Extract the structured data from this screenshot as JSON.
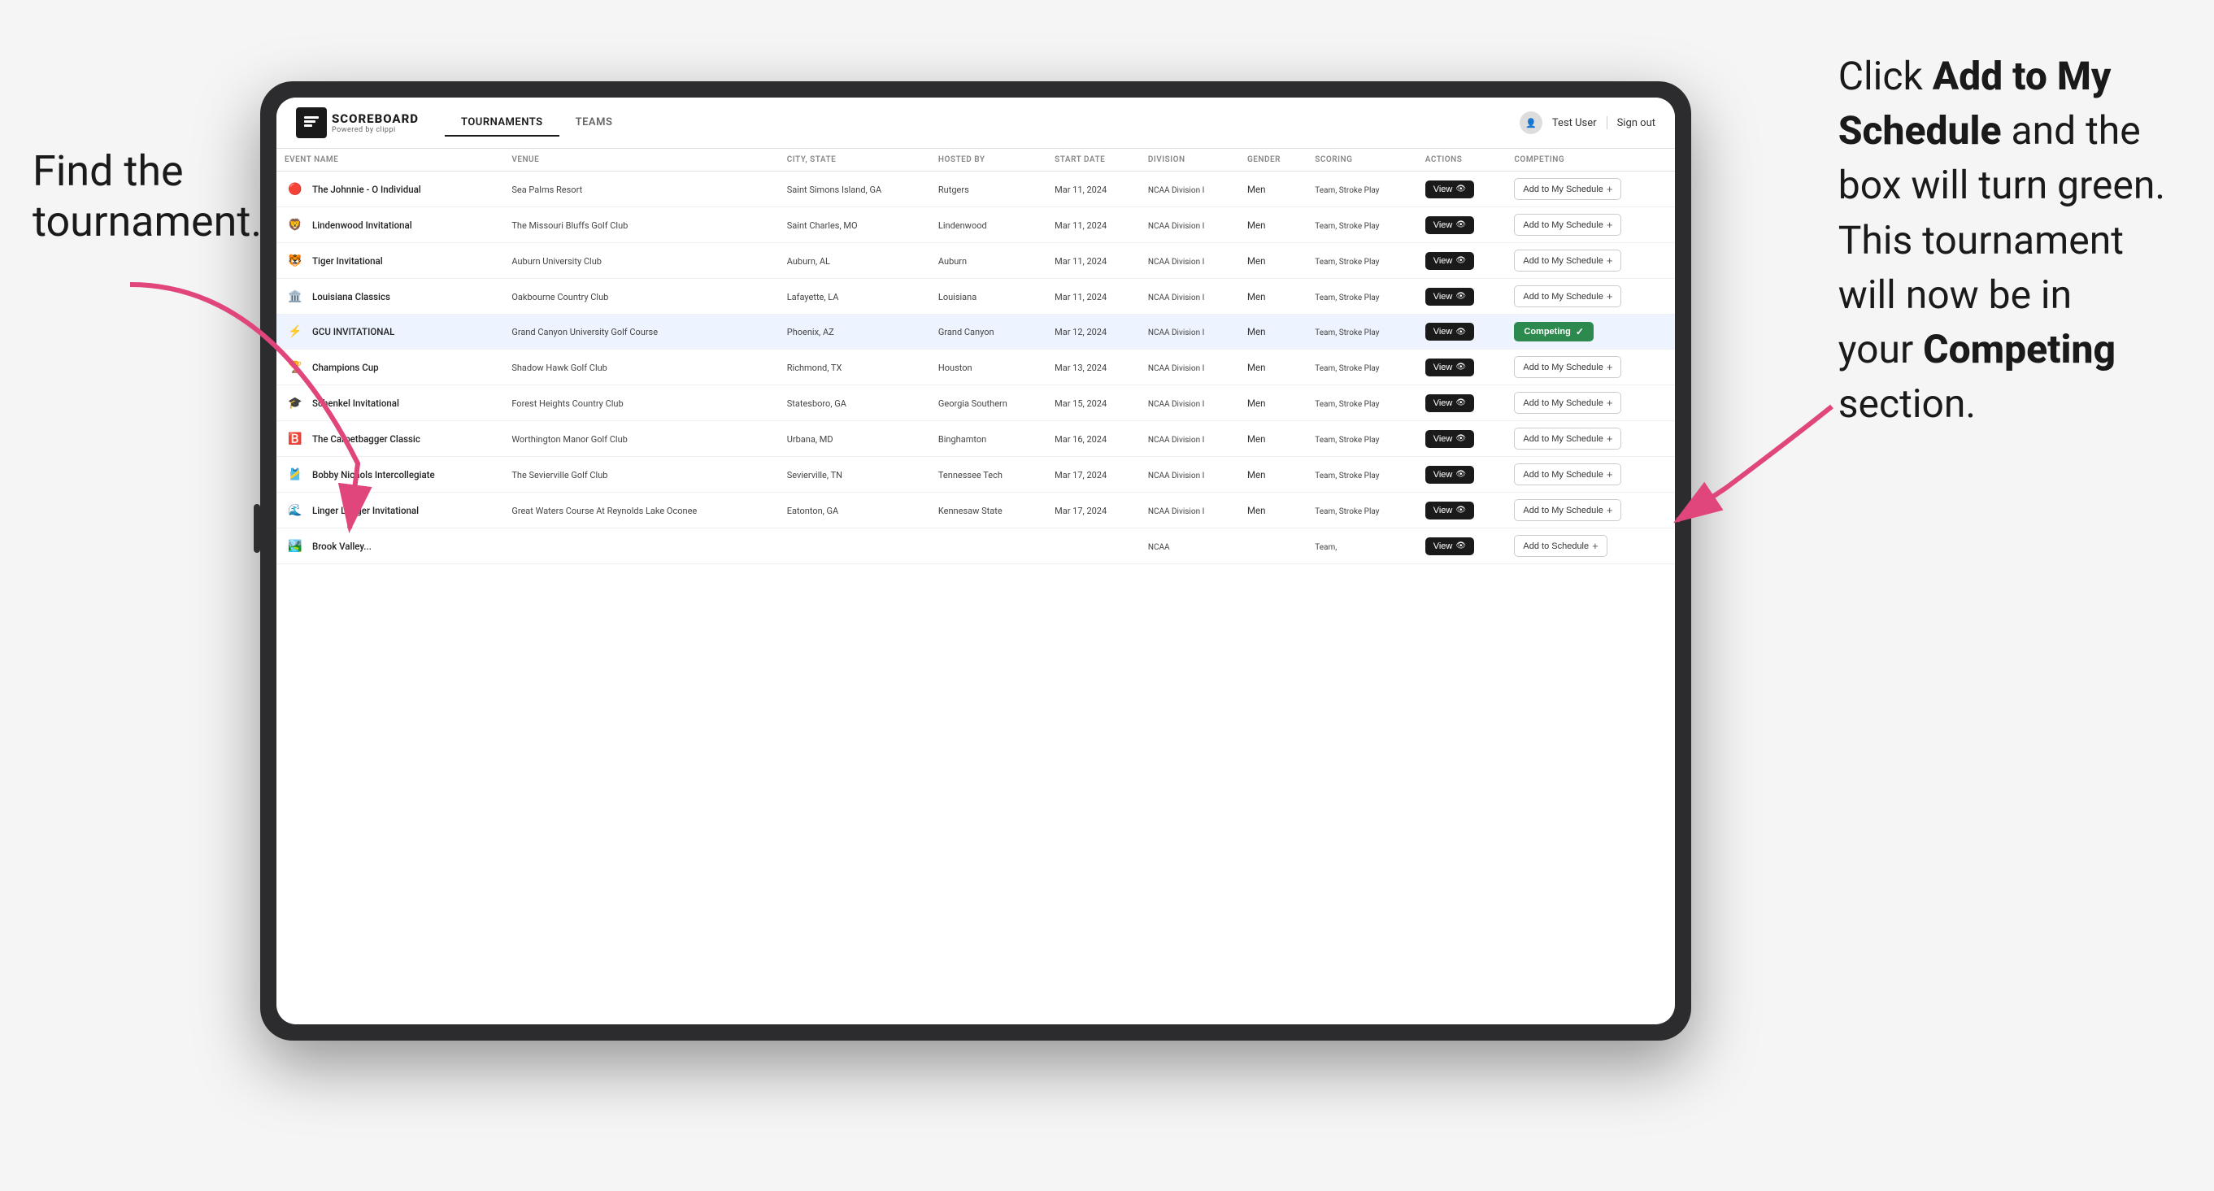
{
  "annotations": {
    "left": "Find the\ntournament.",
    "right_line1": "Click ",
    "right_bold1": "Add to My",
    "right_line2": "Schedule",
    "right_suffix": " and the",
    "right_line3": "box will turn green.",
    "right_line4": "This tournament",
    "right_line5": "will now be in",
    "right_line6": "your ",
    "right_bold2": "Competing",
    "right_line7": " section."
  },
  "header": {
    "logo_title": "SCOREBOARD",
    "logo_subtitle": "Powered by clippi",
    "nav_tabs": [
      {
        "label": "TOURNAMENTS",
        "active": true
      },
      {
        "label": "TEAMS",
        "active": false
      }
    ],
    "user": "Test User",
    "sign_out": "Sign out"
  },
  "table": {
    "columns": [
      "EVENT NAME",
      "VENUE",
      "CITY, STATE",
      "HOSTED BY",
      "START DATE",
      "DIVISION",
      "GENDER",
      "SCORING",
      "ACTIONS",
      "COMPETING"
    ],
    "rows": [
      {
        "logo": "🔴",
        "event_name": "The Johnnie - O Individual",
        "venue": "Sea Palms Resort",
        "city": "Saint Simons Island, GA",
        "hosted_by": "Rutgers",
        "start_date": "Mar 11, 2024",
        "division": "NCAA Division I",
        "gender": "Men",
        "scoring": "Team, Stroke Play",
        "action": "View",
        "competing": "Add to My Schedule",
        "highlighted": false,
        "competing_active": false
      },
      {
        "logo": "🦁",
        "event_name": "Lindenwood Invitational",
        "venue": "The Missouri Bluffs Golf Club",
        "city": "Saint Charles, MO",
        "hosted_by": "Lindenwood",
        "start_date": "Mar 11, 2024",
        "division": "NCAA Division I",
        "gender": "Men",
        "scoring": "Team, Stroke Play",
        "action": "View",
        "competing": "Add to My Schedule",
        "highlighted": false,
        "competing_active": false
      },
      {
        "logo": "🐯",
        "event_name": "Tiger Invitational",
        "venue": "Auburn University Club",
        "city": "Auburn, AL",
        "hosted_by": "Auburn",
        "start_date": "Mar 11, 2024",
        "division": "NCAA Division I",
        "gender": "Men",
        "scoring": "Team, Stroke Play",
        "action": "View",
        "competing": "Add to My Schedule",
        "highlighted": false,
        "competing_active": false
      },
      {
        "logo": "🏛️",
        "event_name": "Louisiana Classics",
        "venue": "Oakbourne Country Club",
        "city": "Lafayette, LA",
        "hosted_by": "Louisiana",
        "start_date": "Mar 11, 2024",
        "division": "NCAA Division I",
        "gender": "Men",
        "scoring": "Team, Stroke Play",
        "action": "View",
        "competing": "Add to My Schedule",
        "highlighted": false,
        "competing_active": false
      },
      {
        "logo": "⚡",
        "event_name": "GCU INVITATIONAL",
        "venue": "Grand Canyon University Golf Course",
        "city": "Phoenix, AZ",
        "hosted_by": "Grand Canyon",
        "start_date": "Mar 12, 2024",
        "division": "NCAA Division I",
        "gender": "Men",
        "scoring": "Team, Stroke Play",
        "action": "View",
        "competing": "Competing",
        "highlighted": true,
        "competing_active": true
      },
      {
        "logo": "🏆",
        "event_name": "Champions Cup",
        "venue": "Shadow Hawk Golf Club",
        "city": "Richmond, TX",
        "hosted_by": "Houston",
        "start_date": "Mar 13, 2024",
        "division": "NCAA Division I",
        "gender": "Men",
        "scoring": "Team, Stroke Play",
        "action": "View",
        "competing": "Add to My Schedule",
        "highlighted": false,
        "competing_active": false
      },
      {
        "logo": "🎓",
        "event_name": "Schenkel Invitational",
        "venue": "Forest Heights Country Club",
        "city": "Statesboro, GA",
        "hosted_by": "Georgia Southern",
        "start_date": "Mar 15, 2024",
        "division": "NCAA Division I",
        "gender": "Men",
        "scoring": "Team, Stroke Play",
        "action": "View",
        "competing": "Add to My Schedule",
        "highlighted": false,
        "competing_active": false
      },
      {
        "logo": "🅱️",
        "event_name": "The Carpetbagger Classic",
        "venue": "Worthington Manor Golf Club",
        "city": "Urbana, MD",
        "hosted_by": "Binghamton",
        "start_date": "Mar 16, 2024",
        "division": "NCAA Division I",
        "gender": "Men",
        "scoring": "Team, Stroke Play",
        "action": "View",
        "competing": "Add to My Schedule",
        "highlighted": false,
        "competing_active": false
      },
      {
        "logo": "🎽",
        "event_name": "Bobby Nichols Intercollegiate",
        "venue": "The Sevierville Golf Club",
        "city": "Sevierville, TN",
        "hosted_by": "Tennessee Tech",
        "start_date": "Mar 17, 2024",
        "division": "NCAA Division I",
        "gender": "Men",
        "scoring": "Team, Stroke Play",
        "action": "View",
        "competing": "Add to My Schedule",
        "highlighted": false,
        "competing_active": false
      },
      {
        "logo": "🌊",
        "event_name": "Linger Longer Invitational",
        "venue": "Great Waters Course At Reynolds Lake Oconee",
        "city": "Eatonton, GA",
        "hosted_by": "Kennesaw State",
        "start_date": "Mar 17, 2024",
        "division": "NCAA Division I",
        "gender": "Men",
        "scoring": "Team, Stroke Play",
        "action": "View",
        "competing": "Add to My Schedule",
        "highlighted": false,
        "competing_active": false
      },
      {
        "logo": "🏞️",
        "event_name": "Brook Valley...",
        "venue": "",
        "city": "",
        "hosted_by": "",
        "start_date": "",
        "division": "NCAA",
        "gender": "",
        "scoring": "Team,",
        "action": "View",
        "competing": "Add to Schedule",
        "highlighted": false,
        "competing_active": false
      }
    ]
  },
  "colors": {
    "competing_green": "#2d8a4e",
    "view_btn_dark": "#1a1a1a",
    "highlighted_row_bg": "#eef4ff",
    "arrow_pink": "#e0457b"
  }
}
